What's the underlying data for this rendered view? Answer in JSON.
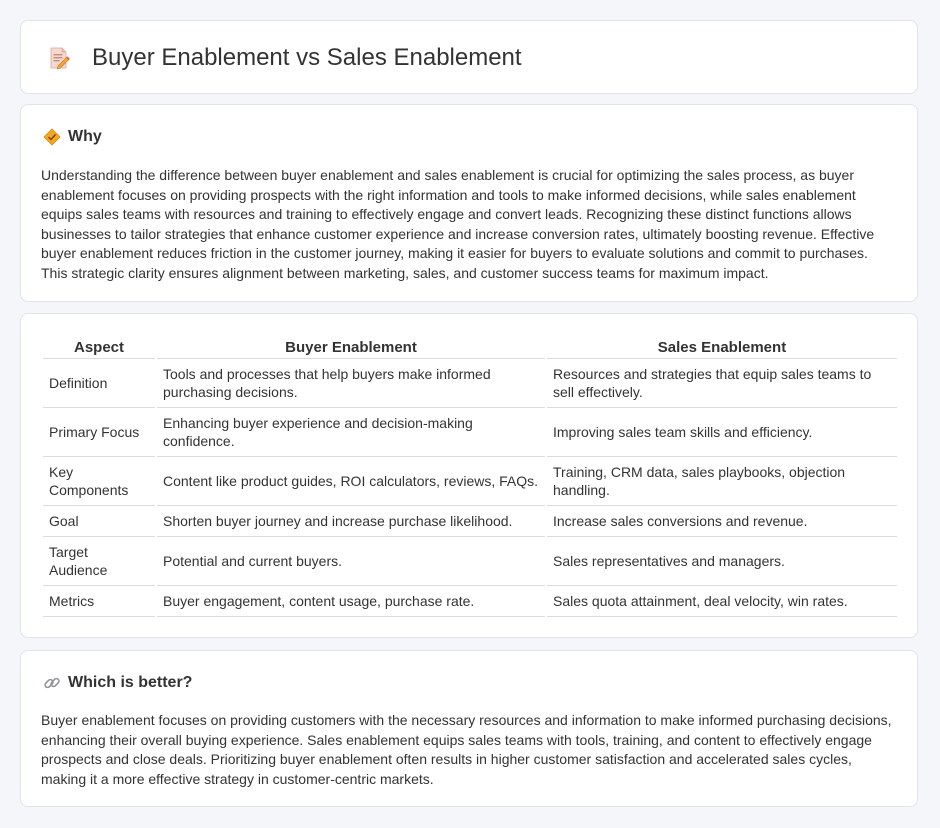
{
  "header": {
    "title": "Buyer Enablement vs Sales Enablement",
    "icon": "document-edit-icon"
  },
  "why": {
    "title": "Why",
    "icon": "diamond-warning-icon",
    "body": "Understanding the difference between buyer enablement and sales enablement is crucial for optimizing the sales process, as buyer enablement focuses on providing prospects with the right information and tools to make informed decisions, while sales enablement equips sales teams with resources and training to effectively engage and convert leads. Recognizing these distinct functions allows businesses to tailor strategies that enhance customer experience and increase conversion rates, ultimately boosting revenue. Effective buyer enablement reduces friction in the customer journey, making it easier for buyers to evaluate solutions and commit to purchases. This strategic clarity ensures alignment between marketing, sales, and customer success teams for maximum impact."
  },
  "table": {
    "headers": [
      "Aspect",
      "Buyer Enablement",
      "Sales Enablement"
    ],
    "rows": [
      [
        "Definition",
        "Tools and processes that help buyers make informed purchasing decisions.",
        "Resources and strategies that equip sales teams to sell effectively."
      ],
      [
        "Primary Focus",
        "Enhancing buyer experience and decision-making confidence.",
        "Improving sales team skills and efficiency."
      ],
      [
        "Key Components",
        "Content like product guides, ROI calculators, reviews, FAQs.",
        "Training, CRM data, sales playbooks, objection handling."
      ],
      [
        "Goal",
        "Shorten buyer journey and increase purchase likelihood.",
        "Increase sales conversions and revenue."
      ],
      [
        "Target Audience",
        "Potential and current buyers.",
        "Sales representatives and managers."
      ],
      [
        "Metrics",
        "Buyer engagement, content usage, purchase rate.",
        "Sales quota attainment, deal velocity, win rates."
      ]
    ]
  },
  "better": {
    "title": "Which is better?",
    "icon": "link-icon",
    "body": "Buyer enablement focuses on providing customers with the necessary resources and information to make informed purchasing decisions, enhancing their overall buying experience. Sales enablement equips sales teams with tools, training, and content to effectively engage prospects and close deals. Prioritizing buyer enablement often results in higher customer satisfaction and accelerated sales cycles, making it a more effective strategy in customer-centric markets."
  },
  "colors": {
    "background": "#f4f6f9",
    "card": "#ffffff",
    "border": "#e1e4e8",
    "text": "#333333",
    "accent": "#f5a623"
  }
}
